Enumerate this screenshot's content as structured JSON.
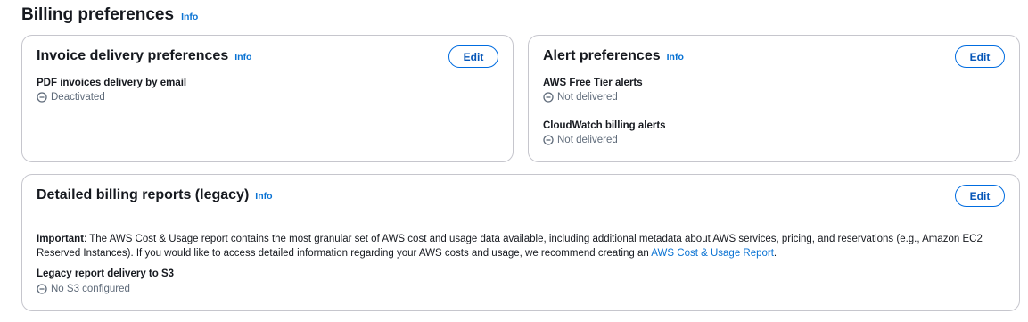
{
  "page": {
    "title": "Billing preferences",
    "info_label": "Info"
  },
  "invoice_card": {
    "title": "Invoice delivery preferences",
    "info_label": "Info",
    "edit_label": "Edit",
    "field_label": "PDF invoices delivery by email",
    "status": "Deactivated",
    "status_icon": "minus-circle-icon"
  },
  "alert_card": {
    "title": "Alert preferences",
    "info_label": "Info",
    "edit_label": "Edit",
    "fields": [
      {
        "label": "AWS Free Tier alerts",
        "status": "Not delivered"
      },
      {
        "label": "CloudWatch billing alerts",
        "status": "Not delivered"
      }
    ]
  },
  "billing_reports_card": {
    "title": "Detailed billing reports (legacy)",
    "info_label": "Info",
    "edit_label": "Edit",
    "important_label": "Important",
    "important_text": ": The AWS Cost & Usage report contains the most granular set of AWS cost and usage data available, including additional metadata about AWS services, pricing, and reservations (e.g., Amazon EC2 Reserved Instances). If you would like to access detailed information regarding your AWS costs and usage, we recommend creating an ",
    "link_text": "AWS Cost & Usage Report",
    "after_link": ".",
    "field_label": "Legacy report delivery to S3",
    "status": "No S3 configured"
  },
  "colors": {
    "link": "#0972d3",
    "border": "#c6c6cd",
    "status_text": "#5f6b7a",
    "heading": "#16191f"
  }
}
